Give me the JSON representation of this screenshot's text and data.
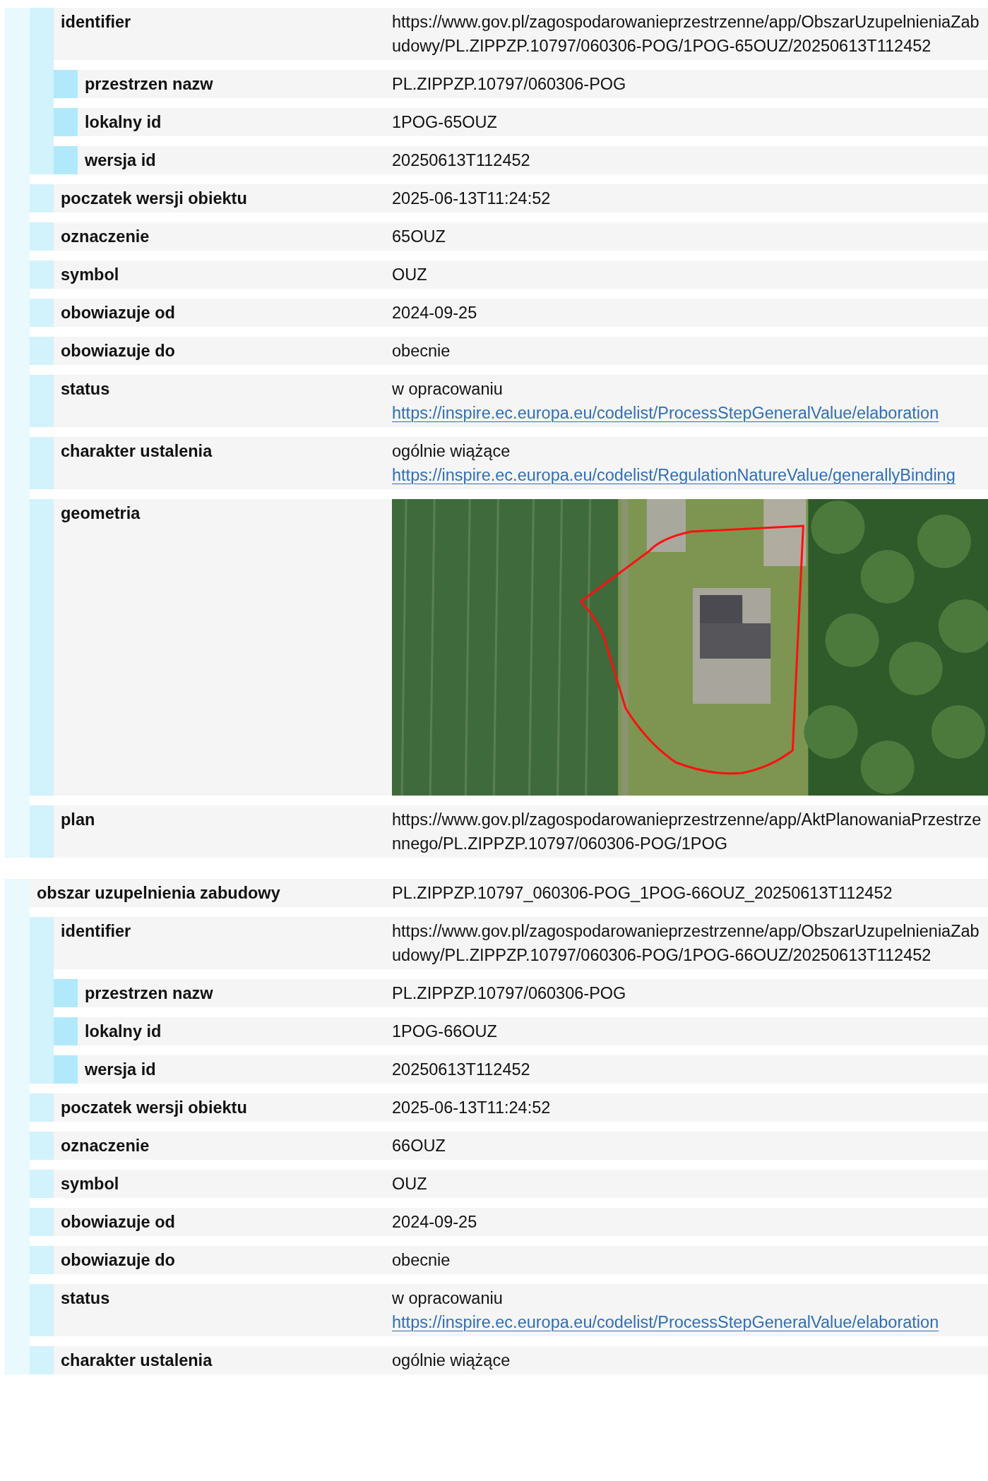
{
  "blocks": [
    {
      "properties": [
        {
          "label": "identifier",
          "kind": "text",
          "value": "https://www.gov.pl/zagospodarowanieprzestrzenne/app/ObszarUzupelnieniaZabudowy/PL.ZIPPZP.10797/060306-POG/1POG-65OUZ/20250613T112452",
          "children": [
            {
              "label": "przestrzen nazw",
              "kind": "text",
              "value": "PL.ZIPPZP.10797/060306-POG"
            },
            {
              "label": "lokalny id",
              "kind": "text",
              "value": "1POG-65OUZ"
            },
            {
              "label": "wersja id",
              "kind": "text",
              "value": "20250613T112452"
            }
          ]
        },
        {
          "label": "poczatek wersji obiektu",
          "kind": "text",
          "value": "2025-06-13T11:24:52"
        },
        {
          "label": "oznaczenie",
          "kind": "text",
          "value": "65OUZ"
        },
        {
          "label": "symbol",
          "kind": "text",
          "value": "OUZ"
        },
        {
          "label": "obowiazuje od",
          "kind": "text",
          "value": "2024-09-25"
        },
        {
          "label": "obowiazuje do",
          "kind": "text",
          "value": "obecnie"
        },
        {
          "label": "status",
          "kind": "link",
          "value": "w opracowaniu",
          "link": "https://inspire.ec.europa.eu/codelist/ProcessStepGeneralValue/elaboration"
        },
        {
          "label": "charakter ustalenia",
          "kind": "link",
          "value": "ogólnie wiążące",
          "link": "https://inspire.ec.europa.eu/codelist/RegulationNatureValue/generallyBinding"
        },
        {
          "label": "geometria",
          "kind": "map"
        },
        {
          "label": "plan",
          "kind": "text",
          "value": "https://www.gov.pl/zagospodarowanieprzestrzenne/app/AktPlanowaniaPrzestrzennego/PL.ZIPPZP.10797/060306-POG/1POG"
        }
      ]
    },
    {
      "header": {
        "label": "obszar uzupelnienia zabudowy",
        "value": "PL.ZIPPZP.10797_060306-POG_1POG-66OUZ_20250613T112452"
      },
      "properties": [
        {
          "label": "identifier",
          "kind": "text",
          "value": "https://www.gov.pl/zagospodarowanieprzestrzenne/app/ObszarUzupelnieniaZabudowy/PL.ZIPPZP.10797/060306-POG/1POG-66OUZ/20250613T112452",
          "children": [
            {
              "label": "przestrzen nazw",
              "kind": "text",
              "value": "PL.ZIPPZP.10797/060306-POG"
            },
            {
              "label": "lokalny id",
              "kind": "text",
              "value": "1POG-66OUZ"
            },
            {
              "label": "wersja id",
              "kind": "text",
              "value": "20250613T112452"
            }
          ]
        },
        {
          "label": "poczatek wersji obiektu",
          "kind": "text",
          "value": "2025-06-13T11:24:52"
        },
        {
          "label": "oznaczenie",
          "kind": "text",
          "value": "66OUZ"
        },
        {
          "label": "symbol",
          "kind": "text",
          "value": "OUZ"
        },
        {
          "label": "obowiazuje od",
          "kind": "text",
          "value": "2024-09-25"
        },
        {
          "label": "obowiazuje do",
          "kind": "text",
          "value": "obecnie"
        },
        {
          "label": "status",
          "kind": "link",
          "value": "w opracowaniu",
          "link": "https://inspire.ec.europa.eu/codelist/ProcessStepGeneralValue/elaboration"
        },
        {
          "label": "charakter ustalenia",
          "kind": "link",
          "value": "ogólnie wiążące"
        }
      ]
    }
  ]
}
